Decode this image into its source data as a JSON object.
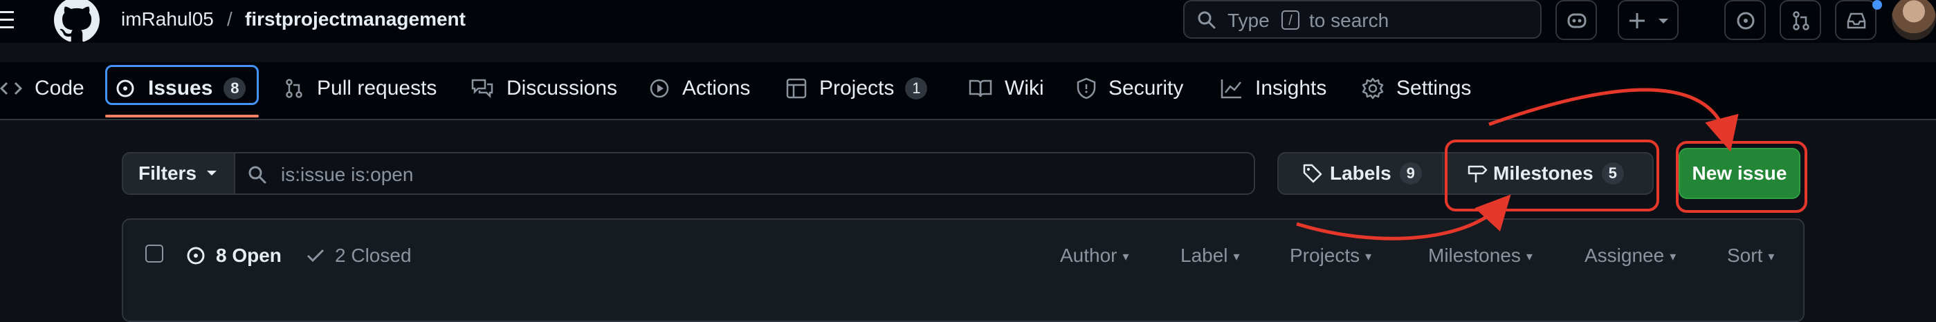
{
  "header": {
    "owner": "imRahul05",
    "separator": "/",
    "repo": "firstprojectmanagement",
    "search_prefix": "Type",
    "search_key": "/",
    "search_suffix": "to search"
  },
  "tabs": [
    {
      "label": "Code"
    },
    {
      "label": "Issues",
      "count": "8"
    },
    {
      "label": "Pull requests"
    },
    {
      "label": "Discussions"
    },
    {
      "label": "Actions"
    },
    {
      "label": "Projects",
      "count": "1"
    },
    {
      "label": "Wiki"
    },
    {
      "label": "Security"
    },
    {
      "label": "Insights"
    },
    {
      "label": "Settings"
    }
  ],
  "toolbar": {
    "filters_label": "Filters",
    "search_value": "is:issue is:open",
    "labels_label": "Labels",
    "labels_count": "9",
    "milestones_label": "Milestones",
    "milestones_count": "5",
    "new_issue_label": "New issue"
  },
  "list": {
    "open_label": "8 Open",
    "closed_label": "2 Closed",
    "columns": [
      "Author",
      "Label",
      "Projects",
      "Milestones",
      "Assignee",
      "Sort"
    ]
  },
  "colors": {
    "background": "#0d1117",
    "topbar": "#010409",
    "accent_blue": "#4493f8",
    "tab_underline": "#f78166",
    "primary_green": "#238636",
    "annotation_red": "#e5382a"
  }
}
